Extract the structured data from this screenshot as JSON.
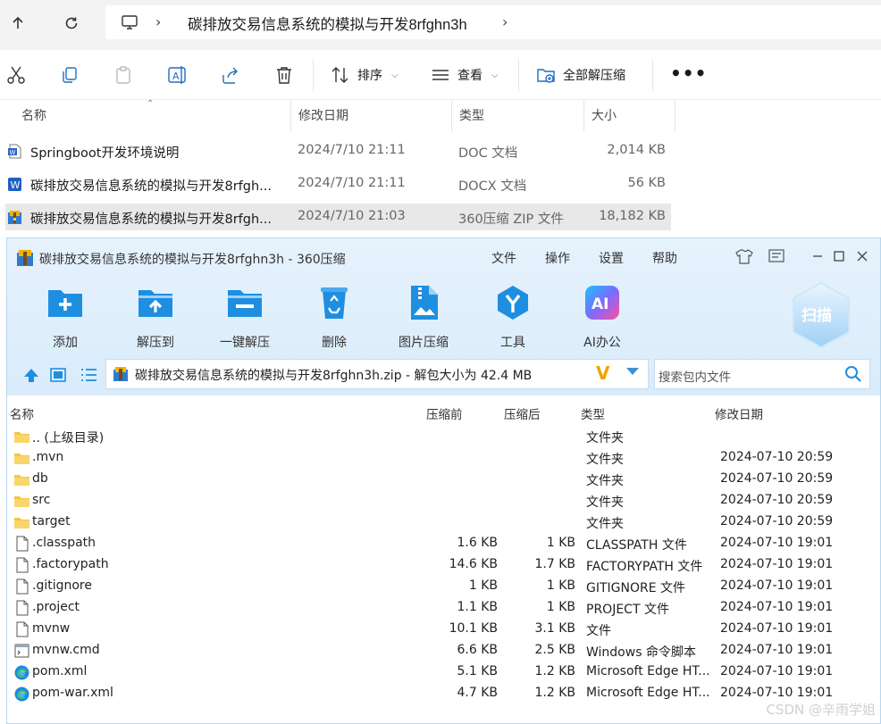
{
  "explorer": {
    "address_path": "碳排放交易信息系统的模拟与开发8rfghn3h",
    "toolbar": {
      "sort_label": "排序",
      "view_label": "查看",
      "extract_all_label": "全部解压缩",
      "more_label": "•••"
    },
    "columns": {
      "name": "名称",
      "modified": "修改日期",
      "type": "类型",
      "size": "大小"
    },
    "files": [
      {
        "icon": "word-doc-icon",
        "name": "Springboot开发环境说明",
        "modified": "2024/7/10 21:11",
        "type": "DOC 文档",
        "size": "2,014 KB",
        "selected": false
      },
      {
        "icon": "word-docx-icon",
        "name": "碳排放交易信息系统的模拟与开发8rfgh...",
        "modified": "2024/7/10 21:11",
        "type": "DOCX 文档",
        "size": "56 KB",
        "selected": false
      },
      {
        "icon": "zip-archive-icon",
        "name": "碳排放交易信息系统的模拟与开发8rfgh...",
        "modified": "2024/7/10 21:03",
        "type": "360压缩 ZIP 文件",
        "size": "18,182 KB",
        "selected": true
      }
    ]
  },
  "zip_window": {
    "title": "碳排放交易信息系统的模拟与开发8rfghn3h - 360压缩",
    "menu": [
      "文件",
      "操作",
      "设置",
      "帮助"
    ],
    "tools": [
      {
        "label": "添加",
        "icon": "add-folder-icon"
      },
      {
        "label": "解压到",
        "icon": "extract-to-icon"
      },
      {
        "label": "一键解压",
        "icon": "one-click-extract-icon"
      },
      {
        "label": "删除",
        "icon": "recycle-bin-icon"
      },
      {
        "label": "图片压缩",
        "icon": "image-compress-icon"
      },
      {
        "label": "工具",
        "icon": "tools-icon"
      },
      {
        "label": "AI办公",
        "icon": "ai-office-icon"
      }
    ],
    "scan_label": "扫描",
    "ai_badge": "AI",
    "address": "碳排放交易信息系统的模拟与开发8rfghn3h.zip - 解包大小为 42.4 MB",
    "search_placeholder": "搜索包内文件",
    "columns": {
      "name": "名称",
      "before": "压缩前",
      "after": "压缩后",
      "type": "类型",
      "modified": "修改日期"
    },
    "entries": [
      {
        "icon": "folder-icon",
        "name": ".. (上级目录)",
        "before": "",
        "after": "",
        "type": "文件夹",
        "modified": ""
      },
      {
        "icon": "folder-icon",
        "name": ".mvn",
        "before": "",
        "after": "",
        "type": "文件夹",
        "modified": "2024-07-10 20:59"
      },
      {
        "icon": "folder-icon",
        "name": "db",
        "before": "",
        "after": "",
        "type": "文件夹",
        "modified": "2024-07-10 20:59"
      },
      {
        "icon": "folder-icon",
        "name": "src",
        "before": "",
        "after": "",
        "type": "文件夹",
        "modified": "2024-07-10 20:59"
      },
      {
        "icon": "folder-icon",
        "name": "target",
        "before": "",
        "after": "",
        "type": "文件夹",
        "modified": "2024-07-10 20:59"
      },
      {
        "icon": "file-icon",
        "name": ".classpath",
        "before": "1.6 KB",
        "after": "1 KB",
        "type": "CLASSPATH 文件",
        "modified": "2024-07-10 19:01"
      },
      {
        "icon": "file-icon",
        "name": ".factorypath",
        "before": "14.6 KB",
        "after": "1.7 KB",
        "type": "FACTORYPATH 文件",
        "modified": "2024-07-10 19:01"
      },
      {
        "icon": "file-icon",
        "name": ".gitignore",
        "before": "1 KB",
        "after": "1 KB",
        "type": "GITIGNORE 文件",
        "modified": "2024-07-10 19:01"
      },
      {
        "icon": "file-icon",
        "name": ".project",
        "before": "1.1 KB",
        "after": "1 KB",
        "type": "PROJECT 文件",
        "modified": "2024-07-10 19:01"
      },
      {
        "icon": "file-icon",
        "name": "mvnw",
        "before": "10.1 KB",
        "after": "3.1 KB",
        "type": "文件",
        "modified": "2024-07-10 19:01"
      },
      {
        "icon": "cmd-file-icon",
        "name": "mvnw.cmd",
        "before": "6.6 KB",
        "after": "2.5 KB",
        "type": "Windows 命令脚本",
        "modified": "2024-07-10 19:01"
      },
      {
        "icon": "edge-icon",
        "name": "pom.xml",
        "before": "5.1 KB",
        "after": "1.2 KB",
        "type": "Microsoft Edge HT...",
        "modified": "2024-07-10 19:01"
      },
      {
        "icon": "edge-icon",
        "name": "pom-war.xml",
        "before": "4.7 KB",
        "after": "1.2 KB",
        "type": "Microsoft Edge HT...",
        "modified": "2024-07-10 19:01"
      }
    ]
  },
  "watermark": "CSDN @辛雨学姐",
  "colors": {
    "accent_blue": "#1e8fe0",
    "zip_bg": "#e1effb",
    "selection": "#e8e8e8"
  }
}
